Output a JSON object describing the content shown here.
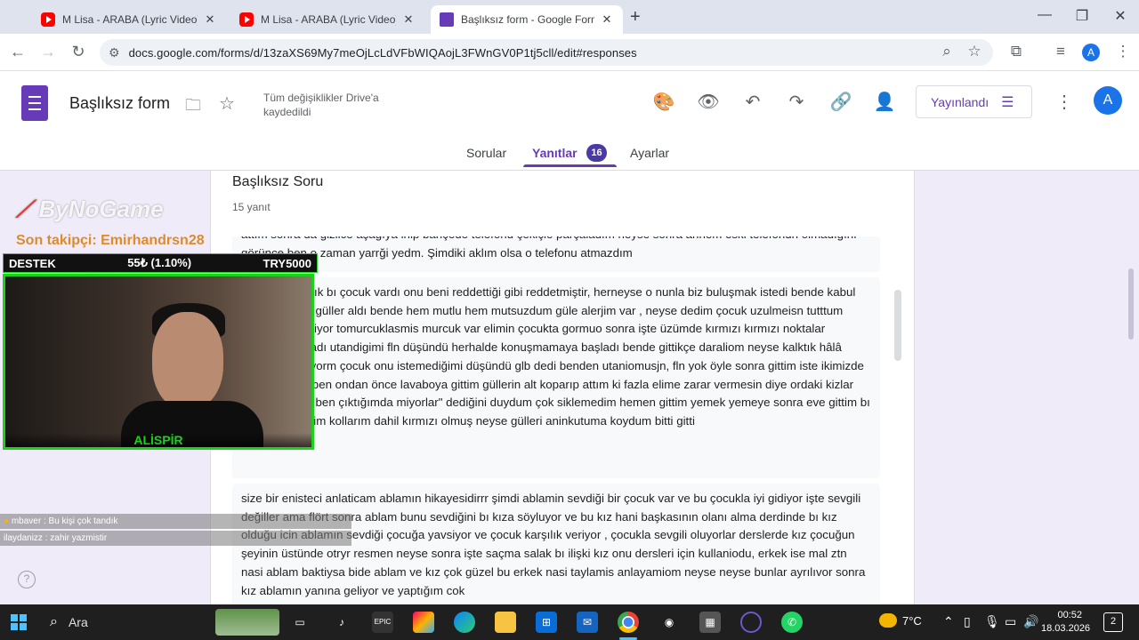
{
  "browser": {
    "tabs": [
      {
        "title": "M Lisa - ARABA (Lyric Video) - Y",
        "favicon": "youtube-icon"
      },
      {
        "title": "M Lisa - ARABA (Lyric Video) - Y",
        "favicon": "youtube-icon"
      },
      {
        "title": "Başlıksız form - Google Formlar",
        "favicon": "google-forms-icon"
      }
    ],
    "url": "docs.google.com/forms/d/13zaXS69My7meOjLcLdVFbWIQAojL3FWnGV0P1tj5cll/edit#responses",
    "profile_initial": "A"
  },
  "form_header": {
    "title": "Başlıksız form",
    "save_status": "Tüm değişiklikler Drive'a kaydedildi",
    "publish_label": "Yayınlandı",
    "avatar_initial": "A"
  },
  "form_tabs": {
    "questions": "Sorular",
    "responses": "Yanıtlar",
    "responses_count": "16",
    "settings": "Ayarlar"
  },
  "question": {
    "title": "Başlıksız Soru",
    "response_count": "15 yanıt",
    "responses": [
      "attım sonra da gizlice aşağıya inip bahçede telefonu çekiçle parçaladım neyse sonra annem eski telefonun olmadığını görünce ben o zaman yarrği yedm. Şimdiki aklım olsa o telefonu atmazdım",
      "atmıştım 3 yıllık bı çocuk vardı onu beni reddettiği gibi reddetmiştir, herneyse o nunla biz buluşmak istedi bende kabul ettim fln bana güller aldı bende hem mutlu hem mutsuzdum güle alerjim var , neyse dedim çocuk uzulmeisn tutttum gülleri elim titriyor tomurcuklasmis murcuk var elimin çocukta gormuo sonra işte üzümde kırmızı kırmızı noktalar çıkmaya başladı utandigimi fln düşündü herhalde konuşmamaya başladı bende gittikçe daraliom neyse kalktık hâlâ gittikçe kızarıyorm çocuk onu istemediğimi düşündü glb dedi benden utaniomusjn, fln yok öyle sonra gittim iste ikimizde evimize gittik ben ondan önce lavaboya gittim güllerin alt koparıp attım ki fazla elime zarar vermesin diye ordaki kizlar bana baktı fln ben çıktığımda miyorlar\" dediğini duydum çok siklemedim hemen gittim yemek yemeye sonra eve gittim bı baktım heryerim kollarım dahil kırmızı olmuş neyse gülleri aninkutuma koydum bitti gitti",
      "size bir enisteci anlaticam ablamın hikayesidirrr şimdi ablamin sevdiği bir çocuk var ve bu çocukla iyi gidiyor işte sevgili değiller ama flört sonra ablam bunu sevdiğini bı kıza söyluyor ve bu kız hani başkasının olanı alma derdinde bı kız olduğu icin ablamın sevdiği çocuğa yavsiyor ve çocuk karşılık veriyor , çocukla sevgili oluyorlar derslerde kız çocuğun şeyinin üstünde otryr resmen neyse sonra işte saçma salak bı ilişki kız onu dersleri için kullaniodu, erkek ise mal ztn nasi ablam baktiysa bide ablam ve kız çok güzel bu erkek nasi taylamis anlayamiom neyse neyse bunlar ayrılıvor sonra kız ablamın yanına geliyor ve yaptığım cok"
    ]
  },
  "stream_overlay": {
    "logo": "ByNoGame",
    "last_follower": "Son takipçi: Emirhandrsn28",
    "destek_label": "DESTEK",
    "destek_progress": "55₺ (1.10%)",
    "destek_goal": "TRY5000",
    "cam_name": "ALİSPİR",
    "chat": [
      {
        "user": "mbaver",
        "message": "Bu kişi çok tandık"
      },
      {
        "user": "ilaydanizz",
        "message": "zahir yazmistir"
      }
    ]
  },
  "taskbar": {
    "search_placeholder": "Ara",
    "weather": "7°C",
    "time": "00:52",
    "date": "18.03.2026",
    "notifications": "2"
  },
  "colors": {
    "accent": "#673ab7",
    "brand_red": "#ff0000",
    "stream_green": "#1bd11b",
    "follower_orange": "#e08a2a"
  }
}
